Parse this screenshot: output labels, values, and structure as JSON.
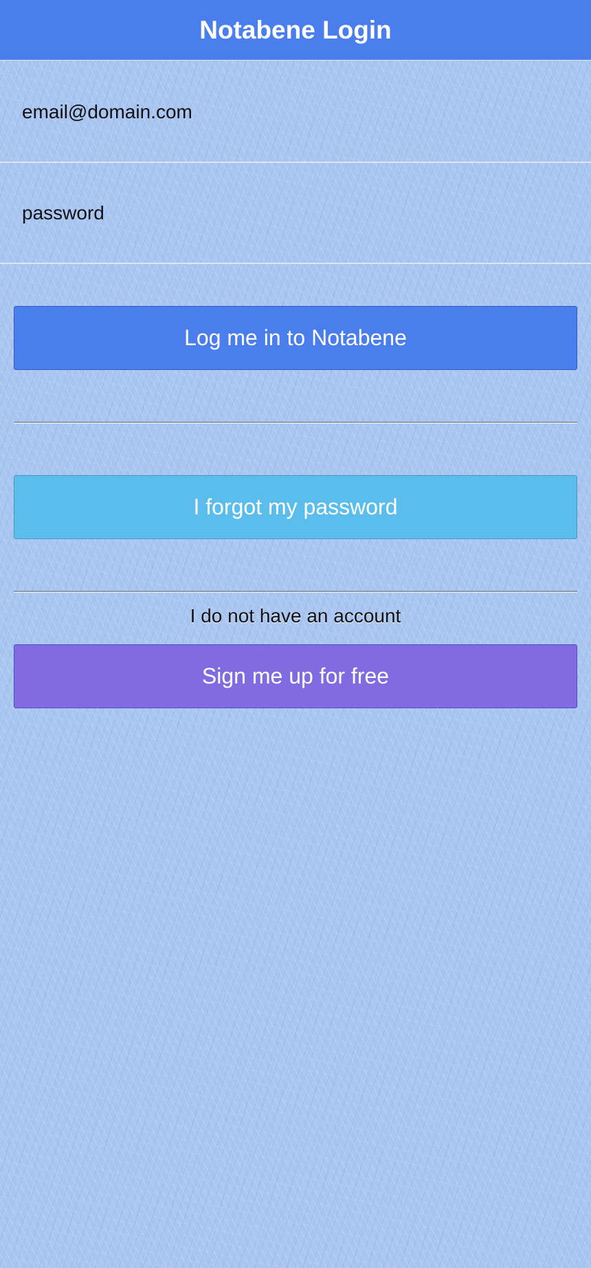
{
  "header": {
    "title": "Notabene Login"
  },
  "form": {
    "email_placeholder": "email@domain.com",
    "email_value": "",
    "password_placeholder": "password",
    "password_value": ""
  },
  "buttons": {
    "login_label": "Log me in to Notabene",
    "forgot_label": "I forgot my password",
    "signup_label": "Sign me up for free"
  },
  "signup_section": {
    "prompt": "I do not have an account"
  },
  "colors": {
    "header_bg": "#4a7eec",
    "login_button": "#4a7eec",
    "forgot_button": "#5bbdec",
    "signup_button": "#806ce0",
    "page_bg": "#a9c6f2"
  }
}
